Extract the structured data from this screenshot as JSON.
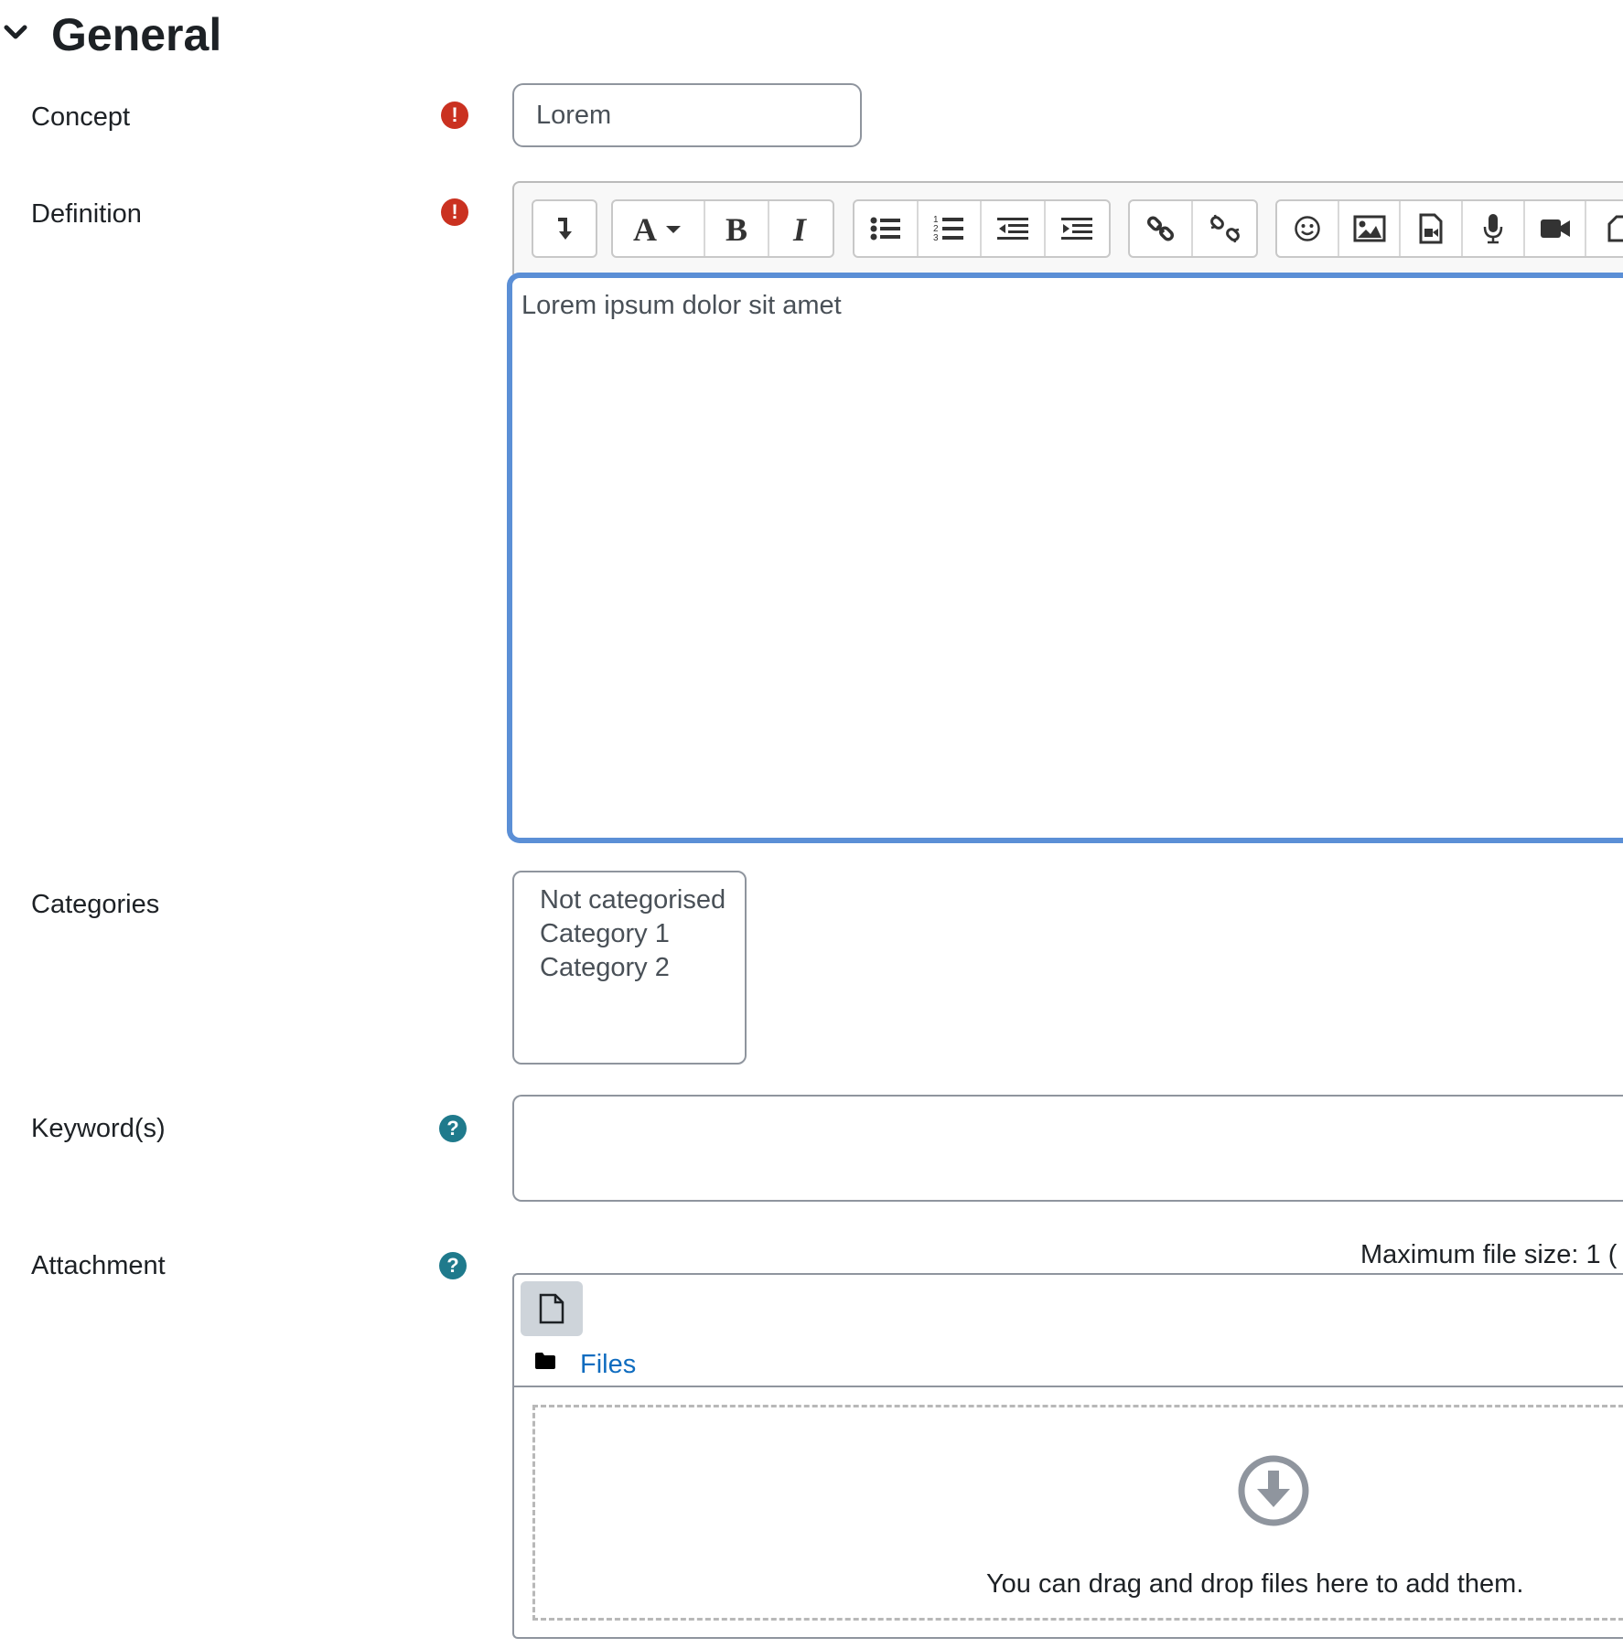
{
  "section": {
    "title": "General",
    "chevron_icon": "chevron-down-icon"
  },
  "fields": {
    "concept": {
      "label": "Concept",
      "value": "Lorem",
      "required_icon": "exclamation-circle-icon"
    },
    "definition": {
      "label": "Definition",
      "content": "Lorem ipsum dolor sit amet",
      "required_icon": "exclamation-circle-icon"
    },
    "categories": {
      "label": "Categories",
      "options": [
        "Not categorised",
        "Category 1",
        "Category 2"
      ]
    },
    "keywords": {
      "label": "Keyword(s)",
      "value": "",
      "help_icon": "question-circle-icon"
    },
    "attachment": {
      "label": "Attachment",
      "help_icon": "question-circle-icon",
      "max_size_text": "Maximum file size: 1 (",
      "files_link": "Files",
      "drop_text": "You can drag and drop files here to add them."
    }
  },
  "editor_toolbar": {
    "groups": [
      [
        "collapse-icon"
      ],
      [
        "font-style-icon",
        "bold-icon",
        "italic-icon"
      ],
      [
        "unordered-list-icon",
        "ordered-list-icon",
        "outdent-icon",
        "indent-icon"
      ],
      [
        "link-icon",
        "unlink-icon"
      ],
      [
        "emoji-icon",
        "image-icon",
        "media-icon",
        "microphone-icon",
        "video-icon",
        "more-icon"
      ]
    ]
  },
  "colors": {
    "required": "#ca3120",
    "help": "#1f7a8c",
    "link": "#0f6cbf",
    "editor_focus": "#5b8fd6"
  }
}
